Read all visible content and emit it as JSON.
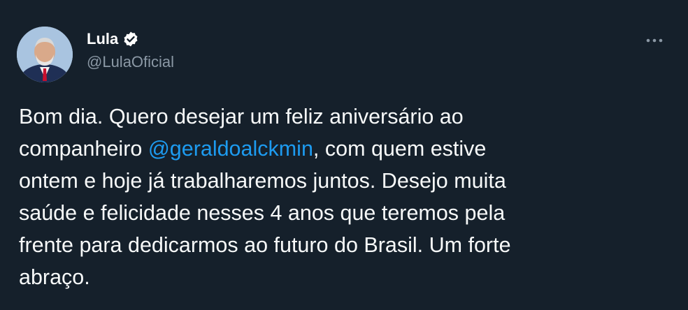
{
  "author": {
    "display_name": "Lula",
    "handle": "@LulaOficial",
    "verified": true
  },
  "tweet": {
    "text_before_mention": "Bom dia. Quero desejar um feliz aniversário ao\ncompanheiro ",
    "mention": "@geraldoalckmin",
    "text_after_mention": ", com quem estive\nontem e hoje já trabalharemos juntos. Desejo muita\nsaúde e felicidade nesses 4 anos que teremos pela\nfrente para dedicarmos ao futuro do Brasil. Um forte\nabraço."
  },
  "icons": {
    "verified": "verified-badge-icon",
    "more": "more-options-icon"
  },
  "colors": {
    "background": "#15202b",
    "text": "#f7f9f9",
    "secondary_text": "#8b98a5",
    "link": "#1d9bf0"
  }
}
